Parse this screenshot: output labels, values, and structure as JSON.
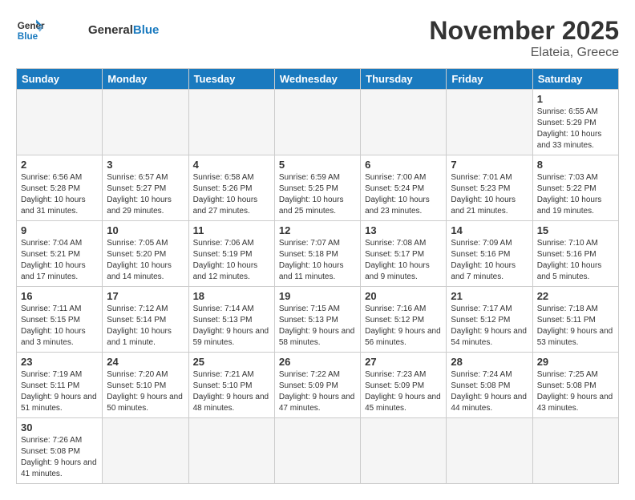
{
  "header": {
    "logo_general": "General",
    "logo_blue": "Blue",
    "month": "November 2025",
    "location": "Elateia, Greece"
  },
  "days_of_week": [
    "Sunday",
    "Monday",
    "Tuesday",
    "Wednesday",
    "Thursday",
    "Friday",
    "Saturday"
  ],
  "weeks": [
    [
      {
        "day": "",
        "info": ""
      },
      {
        "day": "",
        "info": ""
      },
      {
        "day": "",
        "info": ""
      },
      {
        "day": "",
        "info": ""
      },
      {
        "day": "",
        "info": ""
      },
      {
        "day": "",
        "info": ""
      },
      {
        "day": "1",
        "info": "Sunrise: 6:55 AM\nSunset: 5:29 PM\nDaylight: 10 hours\nand 33 minutes."
      }
    ],
    [
      {
        "day": "2",
        "info": "Sunrise: 6:56 AM\nSunset: 5:28 PM\nDaylight: 10 hours\nand 31 minutes."
      },
      {
        "day": "3",
        "info": "Sunrise: 6:57 AM\nSunset: 5:27 PM\nDaylight: 10 hours\nand 29 minutes."
      },
      {
        "day": "4",
        "info": "Sunrise: 6:58 AM\nSunset: 5:26 PM\nDaylight: 10 hours\nand 27 minutes."
      },
      {
        "day": "5",
        "info": "Sunrise: 6:59 AM\nSunset: 5:25 PM\nDaylight: 10 hours\nand 25 minutes."
      },
      {
        "day": "6",
        "info": "Sunrise: 7:00 AM\nSunset: 5:24 PM\nDaylight: 10 hours\nand 23 minutes."
      },
      {
        "day": "7",
        "info": "Sunrise: 7:01 AM\nSunset: 5:23 PM\nDaylight: 10 hours\nand 21 minutes."
      },
      {
        "day": "8",
        "info": "Sunrise: 7:03 AM\nSunset: 5:22 PM\nDaylight: 10 hours\nand 19 minutes."
      }
    ],
    [
      {
        "day": "9",
        "info": "Sunrise: 7:04 AM\nSunset: 5:21 PM\nDaylight: 10 hours\nand 17 minutes."
      },
      {
        "day": "10",
        "info": "Sunrise: 7:05 AM\nSunset: 5:20 PM\nDaylight: 10 hours\nand 14 minutes."
      },
      {
        "day": "11",
        "info": "Sunrise: 7:06 AM\nSunset: 5:19 PM\nDaylight: 10 hours\nand 12 minutes."
      },
      {
        "day": "12",
        "info": "Sunrise: 7:07 AM\nSunset: 5:18 PM\nDaylight: 10 hours\nand 11 minutes."
      },
      {
        "day": "13",
        "info": "Sunrise: 7:08 AM\nSunset: 5:17 PM\nDaylight: 10 hours\nand 9 minutes."
      },
      {
        "day": "14",
        "info": "Sunrise: 7:09 AM\nSunset: 5:16 PM\nDaylight: 10 hours\nand 7 minutes."
      },
      {
        "day": "15",
        "info": "Sunrise: 7:10 AM\nSunset: 5:16 PM\nDaylight: 10 hours\nand 5 minutes."
      }
    ],
    [
      {
        "day": "16",
        "info": "Sunrise: 7:11 AM\nSunset: 5:15 PM\nDaylight: 10 hours\nand 3 minutes."
      },
      {
        "day": "17",
        "info": "Sunrise: 7:12 AM\nSunset: 5:14 PM\nDaylight: 10 hours\nand 1 minute."
      },
      {
        "day": "18",
        "info": "Sunrise: 7:14 AM\nSunset: 5:13 PM\nDaylight: 9 hours\nand 59 minutes."
      },
      {
        "day": "19",
        "info": "Sunrise: 7:15 AM\nSunset: 5:13 PM\nDaylight: 9 hours\nand 58 minutes."
      },
      {
        "day": "20",
        "info": "Sunrise: 7:16 AM\nSunset: 5:12 PM\nDaylight: 9 hours\nand 56 minutes."
      },
      {
        "day": "21",
        "info": "Sunrise: 7:17 AM\nSunset: 5:12 PM\nDaylight: 9 hours\nand 54 minutes."
      },
      {
        "day": "22",
        "info": "Sunrise: 7:18 AM\nSunset: 5:11 PM\nDaylight: 9 hours\nand 53 minutes."
      }
    ],
    [
      {
        "day": "23",
        "info": "Sunrise: 7:19 AM\nSunset: 5:11 PM\nDaylight: 9 hours\nand 51 minutes."
      },
      {
        "day": "24",
        "info": "Sunrise: 7:20 AM\nSunset: 5:10 PM\nDaylight: 9 hours\nand 50 minutes."
      },
      {
        "day": "25",
        "info": "Sunrise: 7:21 AM\nSunset: 5:10 PM\nDaylight: 9 hours\nand 48 minutes."
      },
      {
        "day": "26",
        "info": "Sunrise: 7:22 AM\nSunset: 5:09 PM\nDaylight: 9 hours\nand 47 minutes."
      },
      {
        "day": "27",
        "info": "Sunrise: 7:23 AM\nSunset: 5:09 PM\nDaylight: 9 hours\nand 45 minutes."
      },
      {
        "day": "28",
        "info": "Sunrise: 7:24 AM\nSunset: 5:08 PM\nDaylight: 9 hours\nand 44 minutes."
      },
      {
        "day": "29",
        "info": "Sunrise: 7:25 AM\nSunset: 5:08 PM\nDaylight: 9 hours\nand 43 minutes."
      }
    ],
    [
      {
        "day": "30",
        "info": "Sunrise: 7:26 AM\nSunset: 5:08 PM\nDaylight: 9 hours\nand 41 minutes."
      },
      {
        "day": "",
        "info": ""
      },
      {
        "day": "",
        "info": ""
      },
      {
        "day": "",
        "info": ""
      },
      {
        "day": "",
        "info": ""
      },
      {
        "day": "",
        "info": ""
      },
      {
        "day": "",
        "info": ""
      }
    ]
  ]
}
